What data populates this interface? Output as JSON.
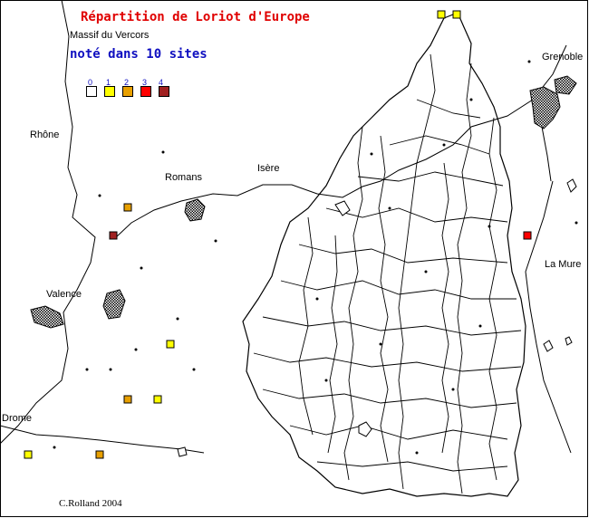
{
  "title": "Répartition de Loriot d'Europe",
  "subtitle": "Massif du Vercors",
  "sites_note": "noté dans 10 sites",
  "credit": "C.Rolland 2004",
  "places": {
    "grenoble": "Grenoble",
    "rhone": "Rhône",
    "romans": "Romans",
    "isere": "Isère",
    "valence": "Valence",
    "la_mure": "La Mure",
    "drome": "Drome"
  },
  "legend": [
    {
      "label": "0",
      "color": "#ffffff"
    },
    {
      "label": "1",
      "color": "#ffff00"
    },
    {
      "label": "2",
      "color": "#e8a000"
    },
    {
      "label": "3",
      "color": "#ff0000"
    },
    {
      "label": "4",
      "color": "#a02020"
    }
  ],
  "sites": [
    {
      "level": 1
    },
    {
      "level": 1
    },
    {
      "level": 2
    },
    {
      "level": 4
    },
    {
      "level": 3
    },
    {
      "level": 1
    },
    {
      "level": 2
    },
    {
      "level": 1
    },
    {
      "level": 1
    },
    {
      "level": 2
    }
  ]
}
